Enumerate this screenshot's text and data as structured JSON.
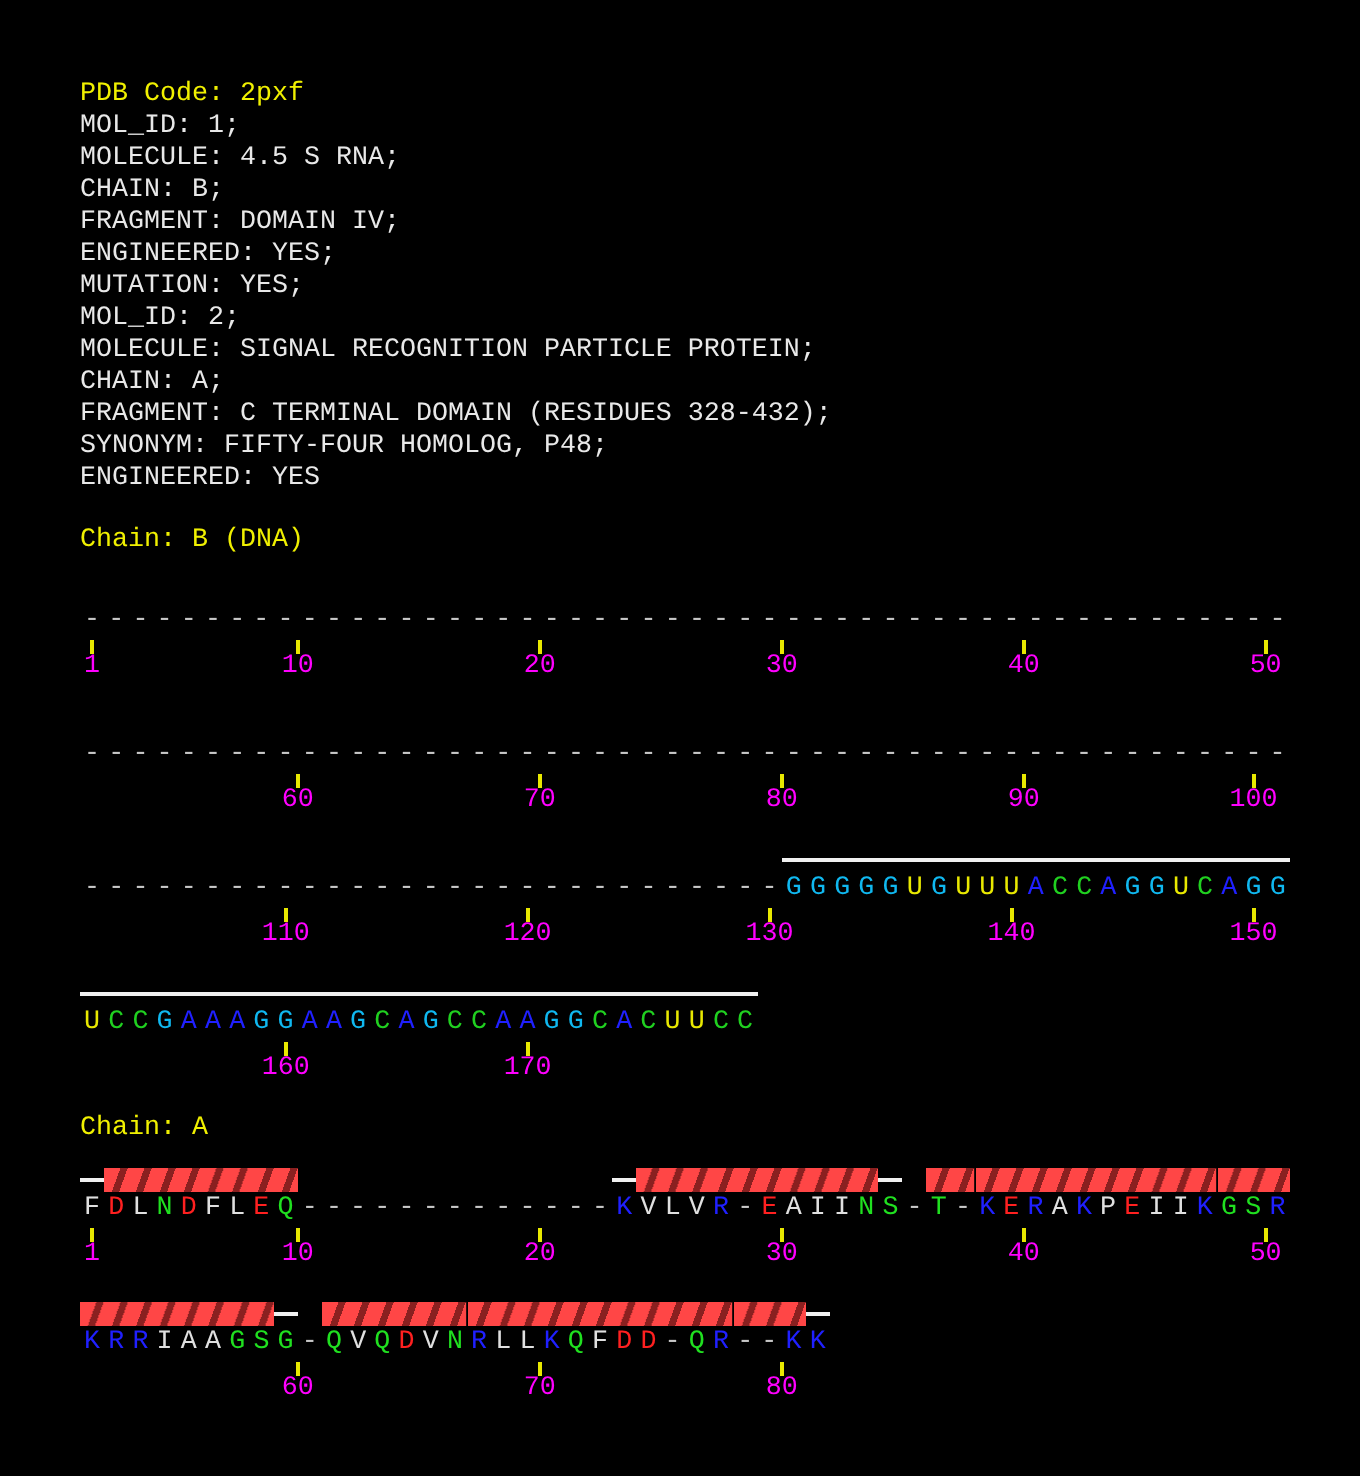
{
  "header": {
    "title": "PDB Code: 2pxf",
    "lines": [
      "MOL_ID: 1;",
      "MOLECULE: 4.5 S RNA;",
      "CHAIN: B;",
      "FRAGMENT: DOMAIN IV;",
      "ENGINEERED: YES;",
      "MUTATION: YES;",
      "MOL_ID: 2;",
      "MOLECULE: SIGNAL RECOGNITION PARTICLE PROTEIN;",
      "CHAIN: A;",
      "FRAGMENT: C TERMINAL DOMAIN (RESIDUES 328-432);",
      "SYNONYM: FIFTY-FOUR HOMOLOG, P48;",
      "ENGINEERED: YES"
    ]
  },
  "chains": [
    {
      "title": "Chain: B (DNA)",
      "rows": [
        {
          "ruler": "1       10        20        30        40        50",
          "segments": [
            {
              "text": "--------------------------------------------------",
              "color": "#c8c8c8",
              "kind": "gap"
            }
          ]
        },
        {
          "ruler": "        60        70        80        90       100",
          "segments": [
            {
              "text": "--------------------------------------------------",
              "color": "#c8c8c8",
              "kind": "gap"
            }
          ]
        },
        {
          "ruler": "       110       120       130       140       150",
          "segments": [
            {
              "text": "-----------------------------",
              "color": "#c8c8c8",
              "kind": "gap"
            },
            {
              "text": "GGGGG",
              "color": "#10b8f0",
              "kind": "line"
            },
            {
              "text": "U",
              "color": "#e8e800",
              "kind": "line"
            },
            {
              "text": "G",
              "color": "#10b8f0",
              "kind": "line"
            },
            {
              "text": "UUU",
              "color": "#e8e800",
              "kind": "line"
            },
            {
              "text": "A",
              "color": "#2020ff",
              "kind": "line"
            },
            {
              "text": "CC",
              "color": "#20d020",
              "kind": "line"
            },
            {
              "text": "A",
              "color": "#2020ff",
              "kind": "line"
            },
            {
              "text": "GG",
              "color": "#10b8f0",
              "kind": "line"
            },
            {
              "text": "U",
              "color": "#e8e800",
              "kind": "line"
            },
            {
              "text": "C",
              "color": "#20d020",
              "kind": "line"
            },
            {
              "text": "A",
              "color": "#2020ff",
              "kind": "line"
            },
            {
              "text": "GG",
              "color": "#10b8f0",
              "kind": "line"
            }
          ]
        },
        {
          "ruler": "       160       170",
          "segments": [
            {
              "text": "U",
              "color": "#e8e800",
              "kind": "line"
            },
            {
              "text": "CC",
              "color": "#20d020",
              "kind": "line"
            },
            {
              "text": "G",
              "color": "#10b8f0",
              "kind": "line"
            },
            {
              "text": "AAA",
              "color": "#2020ff",
              "kind": "line"
            },
            {
              "text": "GG",
              "color": "#10b8f0",
              "kind": "line"
            },
            {
              "text": "AA",
              "color": "#2020ff",
              "kind": "line"
            },
            {
              "text": "G",
              "color": "#10b8f0",
              "kind": "line"
            },
            {
              "text": "C",
              "color": "#20d020",
              "kind": "line"
            },
            {
              "text": "A",
              "color": "#2020ff",
              "kind": "line"
            },
            {
              "text": "G",
              "color": "#10b8f0",
              "kind": "line"
            },
            {
              "text": "CC",
              "color": "#20d020",
              "kind": "line"
            },
            {
              "text": "AA",
              "color": "#2020ff",
              "kind": "line"
            },
            {
              "text": "GG",
              "color": "#10b8f0",
              "kind": "line"
            },
            {
              "text": "C",
              "color": "#20d020",
              "kind": "line"
            },
            {
              "text": "A",
              "color": "#2020ff",
              "kind": "line"
            },
            {
              "text": "C",
              "color": "#20d020",
              "kind": "line"
            },
            {
              "text": "UU",
              "color": "#e8e800",
              "kind": "line"
            },
            {
              "text": "CC",
              "color": "#20d020",
              "kind": "line"
            }
          ]
        }
      ]
    },
    {
      "title": "Chain: A",
      "rows": [
        {
          "ruler": "1       10        20        30        40        50",
          "segments": [
            {
              "text": "F",
              "color": "#e0e0e0",
              "kind": "line"
            },
            {
              "text": "D",
              "color": "#ff2020",
              "kind": "helix"
            },
            {
              "text": "L",
              "color": "#e0e0e0",
              "kind": "helix"
            },
            {
              "text": "N",
              "color": "#20e020",
              "kind": "helix"
            },
            {
              "text": "D",
              "color": "#ff2020",
              "kind": "helix"
            },
            {
              "text": "FL",
              "color": "#e0e0e0",
              "kind": "helix"
            },
            {
              "text": "E",
              "color": "#ff2020",
              "kind": "helix"
            },
            {
              "text": "Q",
              "color": "#20e020",
              "kind": "helix"
            },
            {
              "text": "-------------",
              "color": "#c8c8c8",
              "kind": "gap"
            },
            {
              "text": "K",
              "color": "#2020ff",
              "kind": "line"
            },
            {
              "text": "VLV",
              "color": "#e0e0e0",
              "kind": "helix"
            },
            {
              "text": "R",
              "color": "#2020ff",
              "kind": "helix"
            },
            {
              "text": "-",
              "color": "#c8c8c8",
              "kind": "helix"
            },
            {
              "text": "E",
              "color": "#ff2020",
              "kind": "helix"
            },
            {
              "text": "AII",
              "color": "#e0e0e0",
              "kind": "helix"
            },
            {
              "text": "N",
              "color": "#20e020",
              "kind": "helix"
            },
            {
              "text": "S",
              "color": "#20e020",
              "kind": "line"
            },
            {
              "text": "-",
              "color": "#c8c8c8",
              "kind": "gap"
            },
            {
              "text": "T",
              "color": "#20e020",
              "kind": "helix"
            },
            {
              "text": "-",
              "color": "#c8c8c8",
              "kind": "helix"
            },
            {
              "text": "K",
              "color": "#2020ff",
              "kind": "helix"
            },
            {
              "text": "E",
              "color": "#ff2020",
              "kind": "helix"
            },
            {
              "text": "R",
              "color": "#2020ff",
              "kind": "helix"
            },
            {
              "text": "A",
              "color": "#e0e0e0",
              "kind": "helix"
            },
            {
              "text": "K",
              "color": "#2020ff",
              "kind": "helix"
            },
            {
              "text": "P",
              "color": "#e0e0e0",
              "kind": "helix"
            },
            {
              "text": "E",
              "color": "#ff2020",
              "kind": "helix"
            },
            {
              "text": "II",
              "color": "#e0e0e0",
              "kind": "helix"
            },
            {
              "text": "K",
              "color": "#2020ff",
              "kind": "helix"
            },
            {
              "text": "GS",
              "color": "#20e020",
              "kind": "helix"
            },
            {
              "text": "R",
              "color": "#2020ff",
              "kind": "helix"
            }
          ]
        },
        {
          "ruler": "        60        70        80",
          "segments": [
            {
              "text": "KRR",
              "color": "#2020ff",
              "kind": "helix"
            },
            {
              "text": "IAA",
              "color": "#e0e0e0",
              "kind": "helix"
            },
            {
              "text": "GS",
              "color": "#20e020",
              "kind": "helix"
            },
            {
              "text": "G",
              "color": "#20e020",
              "kind": "line"
            },
            {
              "text": "-",
              "color": "#c8c8c8",
              "kind": "gap"
            },
            {
              "text": "Q",
              "color": "#20e020",
              "kind": "helix"
            },
            {
              "text": "V",
              "color": "#e0e0e0",
              "kind": "helix"
            },
            {
              "text": "Q",
              "color": "#20e020",
              "kind": "helix"
            },
            {
              "text": "D",
              "color": "#ff2020",
              "kind": "helix"
            },
            {
              "text": "V",
              "color": "#e0e0e0",
              "kind": "helix"
            },
            {
              "text": "N",
              "color": "#20e020",
              "kind": "helix"
            },
            {
              "text": "R",
              "color": "#2020ff",
              "kind": "helix"
            },
            {
              "text": "LL",
              "color": "#e0e0e0",
              "kind": "helix"
            },
            {
              "text": "K",
              "color": "#2020ff",
              "kind": "helix"
            },
            {
              "text": "Q",
              "color": "#20e020",
              "kind": "helix"
            },
            {
              "text": "F",
              "color": "#e0e0e0",
              "kind": "helix"
            },
            {
              "text": "DD",
              "color": "#ff2020",
              "kind": "helix"
            },
            {
              "text": "-",
              "color": "#c8c8c8",
              "kind": "helix"
            },
            {
              "text": "Q",
              "color": "#20e020",
              "kind": "helix"
            },
            {
              "text": "R",
              "color": "#2020ff",
              "kind": "helix"
            },
            {
              "text": "--",
              "color": "#c8c8c8",
              "kind": "helix"
            },
            {
              "text": "K",
              "color": "#2020ff",
              "kind": "helix"
            },
            {
              "text": "K",
              "color": "#2020ff",
              "kind": "line"
            }
          ]
        }
      ]
    }
  ]
}
